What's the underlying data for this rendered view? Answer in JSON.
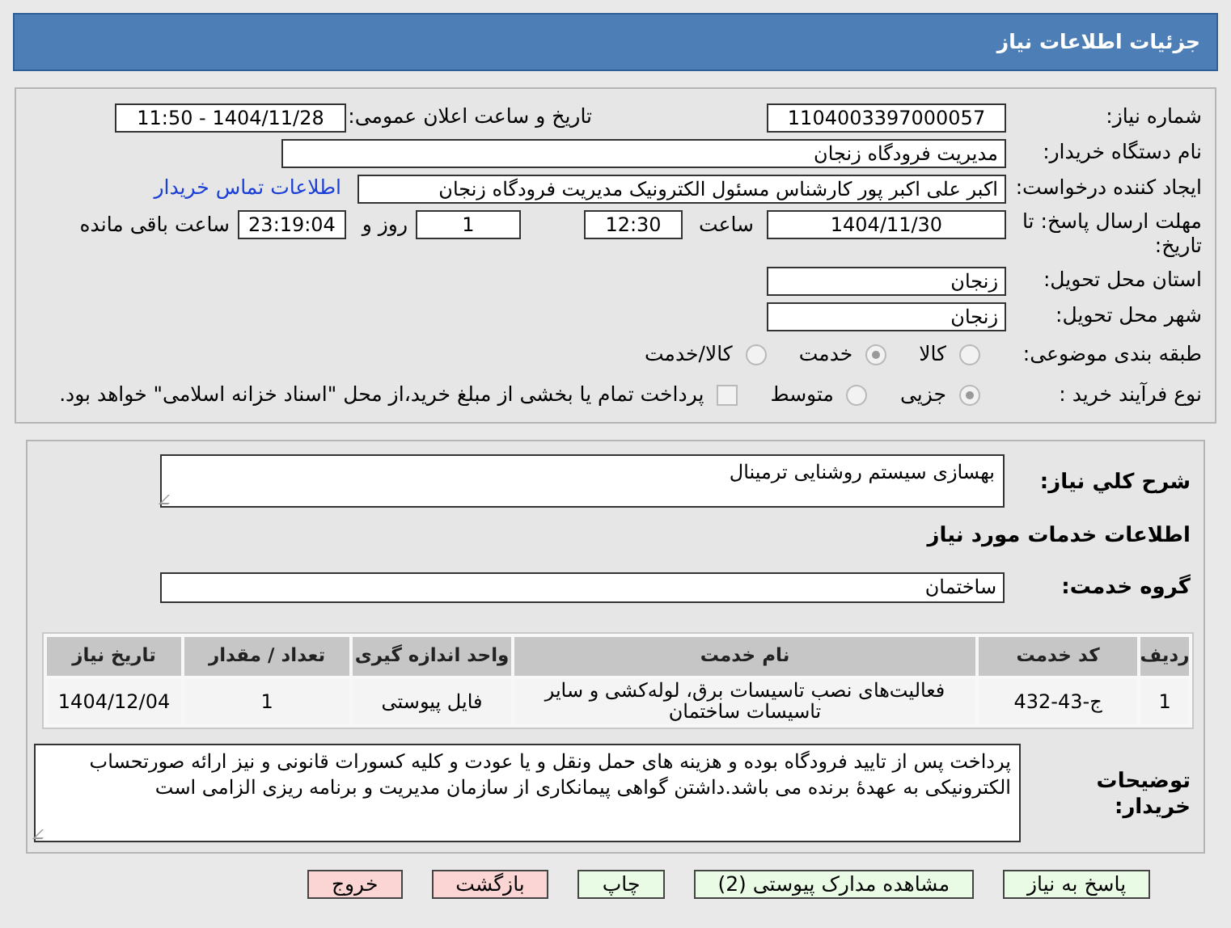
{
  "header": {
    "title": "جزئیات اطلاعات نیاز"
  },
  "details": {
    "need_number": {
      "label": "شماره نیاز:",
      "value": "1104003397000057"
    },
    "announce": {
      "label": "تاریخ و ساعت اعلان عمومی:",
      "value": "1404/11/28 - 11:50"
    },
    "buyer": {
      "label": "نام دستگاه خریدار:",
      "value": "مدیریت فرودگاه زنجان"
    },
    "creator": {
      "label": "ایجاد کننده درخواست:",
      "value": "اکبر علی اکبر پور کارشناس مسئول الکترونیک مدیریت فرودگاه زنجان",
      "link": "اطلاعات تماس خریدار"
    },
    "deadline": {
      "label": "مهلت ارسال پاسخ: تا تاریخ:",
      "date": "1404/11/30",
      "time_label": "ساعت",
      "time": "12:30",
      "days": "1",
      "days_label": "روز و",
      "remaining": "23:19:04",
      "remaining_label": "ساعت باقی مانده"
    },
    "province": {
      "label": "استان محل تحویل:",
      "value": "زنجان"
    },
    "city": {
      "label": "شهر محل تحویل:",
      "value": "زنجان"
    },
    "category": {
      "label": "طبقه بندی موضوعی:",
      "options": [
        {
          "label": "کالا",
          "selected": false
        },
        {
          "label": "خدمت",
          "selected": true
        },
        {
          "label": "کالا/خدمت",
          "selected": false
        }
      ]
    },
    "process": {
      "label": "نوع فرآیند خرید :",
      "options": [
        {
          "label": "جزیی",
          "selected": true
        },
        {
          "label": "متوسط",
          "selected": false
        }
      ],
      "payment": {
        "checked": false,
        "text": "پرداخت تمام یا بخشی از مبلغ خرید،از محل \"اسناد خزانه اسلامی\" خواهد بود."
      }
    }
  },
  "needs": {
    "summary": {
      "label": "شرح کلي نياز:",
      "value": "بهسازی سیستم روشنایی ترمینال"
    },
    "services_title": "اطلاعات خدمات مورد نیاز",
    "service_group": {
      "label": "گروه خدمت:",
      "value": "ساختمان"
    },
    "table": {
      "columns": [
        "ردیف",
        "کد خدمت",
        "نام خدمت",
        "واحد اندازه گیری",
        "تعداد / مقدار",
        "تاریخ نیاز"
      ],
      "rows": [
        [
          "1",
          "ج-43-432",
          "فعالیت‌های نصب تاسیسات برق، لوله‌کشی و سایر تاسیسات ساختمان",
          "فایل پیوستی",
          "1",
          "1404/12/04"
        ]
      ]
    },
    "buyer_notes": {
      "label": "توضیحات خریدار:",
      "value": "پرداخت پس از تایید فرودگاه بوده و هزینه های حمل ونقل و یا عودت و کلیه کسورات قانونی و نیز ارائه صورتحساب الکترونیکی به عهدهٔ برنده می باشد.داشتن گواهی پیمانکاری از سازمان مدیریت و برنامه ریزی الزامی است"
    }
  },
  "buttons": [
    {
      "label": "پاسخ به نیاز",
      "kind": "primary"
    },
    {
      "label": "مشاهده مدارک پیوستی (2)",
      "kind": "primary"
    },
    {
      "label": "چاپ",
      "kind": "primary"
    },
    {
      "label": "بازگشت",
      "kind": "danger"
    },
    {
      "label": "خروج",
      "kind": "danger"
    }
  ]
}
